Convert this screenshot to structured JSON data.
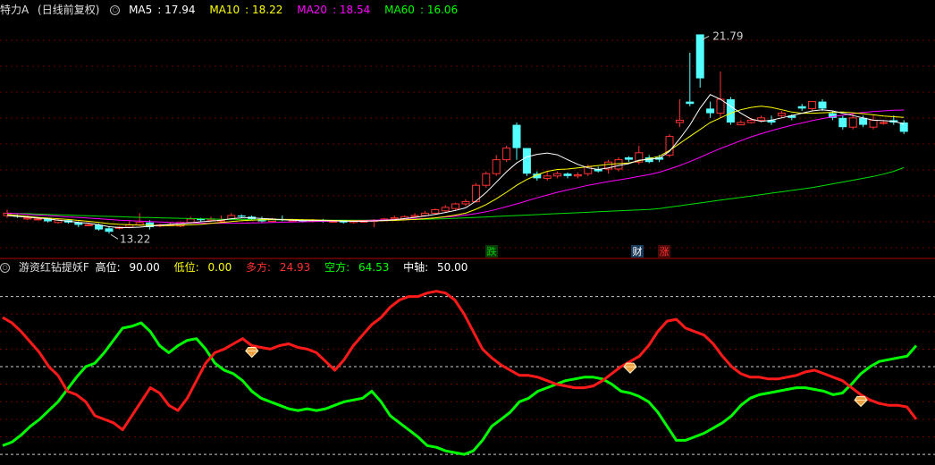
{
  "price_panel": {
    "symbol": "特力A",
    "period": "(日线前复权)",
    "ma": [
      {
        "label": "MA5",
        "value": "17.94",
        "color": "#ffffff"
      },
      {
        "label": "MA10",
        "value": "18.22",
        "color": "#ffff00"
      },
      {
        "label": "MA20",
        "value": "18.54",
        "color": "#ff00ff"
      },
      {
        "label": "MA60",
        "value": "16.06",
        "color": "#00ff00"
      }
    ],
    "high_label": "21.79",
    "low_label": "13.22",
    "markers": [
      {
        "text": "跌",
        "color": "#00cc00",
        "bg": "#0a3a0a"
      },
      {
        "text": "财",
        "color": "#ffffff",
        "bg": "#1a3a5a"
      },
      {
        "text": "涨",
        "color": "#ff3030",
        "bg": "#4a0a0a"
      }
    ]
  },
  "indicator_panel": {
    "name": "游资红钻提妖F",
    "params": [
      {
        "label": "高位:",
        "value": "90.00",
        "color": "#ffffff"
      },
      {
        "label": "低位:",
        "value": "0.00",
        "color": "#ffff00"
      },
      {
        "label": "多方:",
        "value": "24.93",
        "color": "#ff3030"
      },
      {
        "label": "空方:",
        "value": "64.53",
        "color": "#00ff00"
      },
      {
        "label": "中轴:",
        "value": "50.00",
        "color": "#ffffff"
      }
    ]
  },
  "chart_data": {
    "type": "candlestick",
    "ylim": [
      12.5,
      22.5
    ],
    "candles": [
      [
        0,
        14.0,
        14.1,
        14.25,
        13.9
      ],
      [
        1,
        14.0,
        13.95,
        14.05,
        13.9
      ],
      [
        2,
        13.85,
        13.9,
        14.0,
        13.8
      ],
      [
        3,
        13.85,
        13.85,
        13.95,
        13.8
      ],
      [
        4,
        13.85,
        13.75,
        13.9,
        13.7
      ],
      [
        5,
        13.7,
        13.8,
        13.85,
        13.65
      ],
      [
        6,
        13.8,
        13.7,
        13.85,
        13.65
      ],
      [
        7,
        13.7,
        13.6,
        13.75,
        13.5
      ],
      [
        8,
        13.6,
        13.6,
        13.7,
        13.55
      ],
      [
        9,
        13.6,
        13.4,
        13.65,
        13.35
      ],
      [
        10,
        13.45,
        13.3,
        13.5,
        13.22
      ],
      [
        11,
        13.45,
        13.5,
        13.55,
        13.4
      ],
      [
        12,
        13.5,
        13.6,
        13.75,
        13.45
      ],
      [
        13,
        13.6,
        13.7,
        14.1,
        13.55
      ],
      [
        14,
        13.7,
        13.5,
        13.8,
        13.4
      ],
      [
        15,
        13.55,
        13.6,
        13.65,
        13.5
      ],
      [
        16,
        13.6,
        13.6,
        13.7,
        13.55
      ],
      [
        17,
        13.55,
        13.7,
        13.75,
        13.5
      ],
      [
        18,
        13.7,
        13.85,
        13.95,
        13.65
      ],
      [
        19,
        13.85,
        13.8,
        13.9,
        13.75
      ],
      [
        20,
        13.8,
        13.85,
        13.95,
        13.75
      ],
      [
        21,
        13.8,
        13.8,
        14.0,
        13.7
      ],
      [
        22,
        13.85,
        14.0,
        14.1,
        13.8
      ],
      [
        23,
        14.0,
        13.95,
        14.05,
        13.9
      ],
      [
        24,
        13.95,
        13.85,
        14.0,
        13.8
      ],
      [
        25,
        13.85,
        13.75,
        13.95,
        13.7
      ],
      [
        26,
        13.75,
        13.85,
        13.9,
        13.7
      ],
      [
        27,
        13.85,
        13.8,
        14.0,
        13.75
      ],
      [
        28,
        13.8,
        13.8,
        13.85,
        13.75
      ],
      [
        29,
        13.8,
        13.75,
        13.85,
        13.7
      ],
      [
        30,
        13.75,
        13.8,
        13.85,
        13.7
      ],
      [
        31,
        13.8,
        13.75,
        13.85,
        13.7
      ],
      [
        32,
        13.75,
        13.75,
        13.8,
        13.7
      ],
      [
        33,
        13.75,
        13.7,
        13.8,
        13.65
      ],
      [
        34,
        13.7,
        13.75,
        13.8,
        13.65
      ],
      [
        35,
        13.75,
        13.75,
        13.8,
        13.7
      ],
      [
        36,
        13.75,
        13.8,
        13.85,
        13.5
      ],
      [
        37,
        13.8,
        13.85,
        13.9,
        13.75
      ],
      [
        38,
        13.85,
        13.9,
        14.0,
        13.8
      ],
      [
        39,
        13.85,
        13.95,
        14.0,
        13.8
      ],
      [
        40,
        13.95,
        14.0,
        14.1,
        13.9
      ],
      [
        41,
        14.0,
        14.1,
        14.2,
        13.95
      ],
      [
        42,
        14.1,
        14.25,
        14.3,
        14.05
      ],
      [
        43,
        14.2,
        14.35,
        14.45,
        14.15
      ],
      [
        44,
        14.3,
        14.5,
        14.55,
        14.25
      ],
      [
        45,
        14.5,
        14.6,
        14.7,
        14.4
      ],
      [
        46,
        14.6,
        15.3,
        15.4,
        14.55
      ],
      [
        47,
        15.3,
        15.8,
        15.9,
        15.2
      ],
      [
        48,
        15.8,
        16.4,
        16.6,
        15.7
      ],
      [
        49,
        16.4,
        16.9,
        17.0,
        16.3
      ],
      [
        50,
        17.9,
        16.9,
        18.0,
        16.4
      ],
      [
        51,
        16.9,
        15.8,
        16.9,
        15.7
      ],
      [
        52,
        15.8,
        15.6,
        15.9,
        15.5
      ],
      [
        53,
        15.6,
        15.7,
        15.9,
        15.5
      ],
      [
        54,
        15.7,
        15.8,
        15.9,
        15.6
      ],
      [
        55,
        15.8,
        15.7,
        15.85,
        15.6
      ],
      [
        56,
        15.7,
        15.75,
        15.85,
        15.6
      ],
      [
        57,
        15.8,
        16.1,
        16.2,
        15.7
      ],
      [
        58,
        16.0,
        15.9,
        16.1,
        15.85
      ],
      [
        59,
        16.0,
        16.3,
        16.4,
        15.8
      ],
      [
        60,
        16.0,
        16.4,
        16.5,
        15.9
      ],
      [
        61,
        16.5,
        16.4,
        16.55,
        16.3
      ],
      [
        62,
        16.3,
        16.7,
        17.0,
        16.2
      ],
      [
        63,
        16.5,
        16.3,
        16.6,
        16.25
      ],
      [
        64,
        16.5,
        16.4,
        16.6,
        16.3
      ],
      [
        65,
        16.6,
        17.4,
        17.5,
        16.5
      ],
      [
        66,
        18.0,
        18.1,
        19.0,
        17.8
      ],
      [
        67,
        18.9,
        18.8,
        21.0,
        18.7
      ],
      [
        68,
        21.79,
        19.9,
        21.79,
        19.5
      ],
      [
        69,
        18.6,
        18.4,
        18.9,
        18.2
      ],
      [
        70,
        18.4,
        19.0,
        20.2,
        18.2
      ],
      [
        71,
        19.0,
        18.0,
        19.1,
        17.9
      ],
      [
        72,
        17.9,
        18.0,
        18.1,
        17.9
      ],
      [
        73,
        18.0,
        18.1,
        18.2,
        17.95
      ],
      [
        74,
        18.1,
        18.2,
        18.3,
        18.0
      ],
      [
        75,
        18.1,
        18.0,
        18.3,
        17.9
      ],
      [
        76,
        18.3,
        18.4,
        18.5,
        18.2
      ],
      [
        77,
        18.3,
        18.2,
        18.35,
        18.1
      ],
      [
        78,
        18.7,
        18.6,
        18.8,
        18.5
      ],
      [
        79,
        18.6,
        18.9,
        18.9,
        18.5
      ],
      [
        80,
        18.9,
        18.6,
        19.0,
        18.5
      ],
      [
        81,
        18.4,
        18.2,
        18.5,
        18.1
      ],
      [
        82,
        18.2,
        17.8,
        18.3,
        17.7
      ],
      [
        83,
        17.8,
        18.2,
        18.4,
        17.7
      ],
      [
        84,
        18.2,
        17.9,
        18.3,
        17.8
      ],
      [
        85,
        17.8,
        18.1,
        18.3,
        17.7
      ],
      [
        86,
        18.0,
        18.0,
        18.1,
        17.9
      ],
      [
        87,
        18.1,
        18.0,
        18.3,
        17.9
      ],
      [
        88,
        18.0,
        17.6,
        18.1,
        17.5
      ]
    ],
    "ma5": [
      14.0,
      13.96,
      13.93,
      13.89,
      13.86,
      13.8,
      13.76,
      13.7,
      13.67,
      13.6,
      13.52,
      13.48,
      13.48,
      13.5,
      13.54,
      13.58,
      13.62,
      13.64,
      13.68,
      13.73,
      13.76,
      13.8,
      13.86,
      13.9,
      13.9,
      13.87,
      13.85,
      13.82,
      13.8,
      13.78,
      13.78,
      13.78,
      13.77,
      13.76,
      13.75,
      13.75,
      13.77,
      13.79,
      13.82,
      13.87,
      13.92,
      13.98,
      14.05,
      14.13,
      14.22,
      14.33,
      14.62,
      14.99,
      15.43,
      15.88,
      16.26,
      16.52,
      16.63,
      16.69,
      16.61,
      16.4,
      16.2,
      16.05,
      15.98,
      16.05,
      16.15,
      16.23,
      16.38,
      16.42,
      16.46,
      16.76,
      17.3,
      17.89,
      18.62,
      19.2,
      19.0,
      18.7,
      18.4,
      18.15,
      18.05,
      18.1,
      18.2,
      18.3,
      18.4,
      18.5,
      18.55,
      18.5,
      18.4,
      18.3,
      18.2,
      18.1,
      18.08,
      18.05,
      17.94
    ],
    "ma10": [
      14.05,
      14.0,
      13.96,
      13.92,
      13.89,
      13.86,
      13.83,
      13.79,
      13.75,
      13.7,
      13.65,
      13.62,
      13.6,
      13.59,
      13.58,
      13.57,
      13.57,
      13.58,
      13.6,
      13.62,
      13.66,
      13.7,
      13.74,
      13.78,
      13.8,
      13.82,
      13.83,
      13.83,
      13.83,
      13.82,
      13.81,
      13.8,
      13.79,
      13.78,
      13.77,
      13.77,
      13.77,
      13.78,
      13.79,
      13.81,
      13.83,
      13.86,
      13.9,
      13.95,
      14.02,
      14.1,
      14.27,
      14.47,
      14.72,
      15.0,
      15.3,
      15.55,
      15.75,
      15.9,
      15.98,
      16.0,
      16.05,
      16.1,
      16.15,
      16.2,
      16.23,
      16.26,
      16.35,
      16.45,
      16.55,
      16.8,
      17.1,
      17.4,
      17.7,
      18.0,
      18.2,
      18.4,
      18.55,
      18.65,
      18.7,
      18.65,
      18.55,
      18.45,
      18.4,
      18.4,
      18.42,
      18.44,
      18.45,
      18.42,
      18.38,
      18.33,
      18.28,
      18.25,
      18.22
    ],
    "ma20": [
      14.1,
      14.08,
      14.05,
      14.02,
      14.0,
      13.97,
      13.94,
      13.92,
      13.89,
      13.86,
      13.83,
      13.8,
      13.78,
      13.76,
      13.74,
      13.72,
      13.7,
      13.69,
      13.68,
      13.67,
      13.67,
      13.67,
      13.67,
      13.67,
      13.68,
      13.69,
      13.7,
      13.71,
      13.72,
      13.73,
      13.74,
      13.75,
      13.76,
      13.77,
      13.78,
      13.79,
      13.8,
      13.81,
      13.82,
      13.83,
      13.85,
      13.87,
      13.9,
      13.93,
      13.97,
      14.02,
      14.08,
      14.16,
      14.26,
      14.38,
      14.5,
      14.63,
      14.76,
      14.88,
      15.0,
      15.1,
      15.2,
      15.3,
      15.38,
      15.46,
      15.53,
      15.6,
      15.68,
      15.76,
      15.86,
      16.0,
      16.15,
      16.32,
      16.5,
      16.7,
      16.88,
      17.05,
      17.22,
      17.38,
      17.52,
      17.65,
      17.77,
      17.88,
      17.98,
      18.08,
      18.17,
      18.25,
      18.32,
      18.38,
      18.43,
      18.47,
      18.5,
      18.53,
      18.54
    ],
    "ma60": [
      14.1,
      14.09,
      14.08,
      14.06,
      14.05,
      14.03,
      14.02,
      14.0,
      13.99,
      13.97,
      13.96,
      13.95,
      13.93,
      13.92,
      13.91,
      13.9,
      13.89,
      13.88,
      13.87,
      13.86,
      13.85,
      13.84,
      13.83,
      13.83,
      13.82,
      13.82,
      13.81,
      13.81,
      13.8,
      13.8,
      13.8,
      13.8,
      13.8,
      13.8,
      13.8,
      13.8,
      13.8,
      13.81,
      13.81,
      13.82,
      13.83,
      13.84,
      13.85,
      13.86,
      13.88,
      13.9,
      13.92,
      13.94,
      13.96,
      13.98,
      14.0,
      14.02,
      14.04,
      14.06,
      14.08,
      14.1,
      14.12,
      14.14,
      14.16,
      14.18,
      14.2,
      14.22,
      14.24,
      14.26,
      14.3,
      14.36,
      14.42,
      14.48,
      14.54,
      14.6,
      14.66,
      14.72,
      14.78,
      14.84,
      14.9,
      14.96,
      15.02,
      15.08,
      15.14,
      15.2,
      15.28,
      15.36,
      15.44,
      15.52,
      15.6,
      15.68,
      15.78,
      15.9,
      16.06
    ],
    "indicator": {
      "ylim": [
        -2,
        100
      ],
      "red": [
        78,
        75,
        70,
        64,
        58,
        50,
        45,
        36,
        34,
        30,
        22,
        20,
        18,
        14,
        22,
        30,
        38,
        35,
        28,
        25,
        32,
        42,
        52,
        58,
        60,
        63,
        66,
        62,
        61,
        60,
        62,
        63,
        61,
        60,
        58,
        53,
        48,
        54,
        62,
        68,
        74,
        78,
        84,
        88,
        90,
        90,
        92,
        93,
        92,
        88,
        80,
        70,
        60,
        55,
        51,
        48,
        45,
        45,
        44,
        42,
        40,
        39,
        38,
        38,
        39,
        42,
        46,
        50,
        53,
        56,
        62,
        70,
        76,
        77,
        72,
        70,
        68,
        63,
        56,
        50,
        46,
        44,
        44,
        43,
        43,
        44,
        45,
        47,
        48,
        46,
        44,
        42,
        38,
        34,
        31,
        29,
        28,
        28,
        27,
        20
      ],
      "green": [
        5,
        7,
        11,
        16,
        20,
        25,
        30,
        37,
        44,
        50,
        52,
        58,
        65,
        72,
        73,
        75,
        70,
        62,
        58,
        62,
        65,
        66,
        60,
        52,
        48,
        46,
        42,
        36,
        32,
        30,
        28,
        26,
        25,
        26,
        25,
        26,
        28,
        30,
        31,
        32,
        36,
        30,
        22,
        18,
        14,
        10,
        5,
        4,
        2,
        1,
        0,
        2,
        8,
        16,
        20,
        24,
        30,
        32,
        36,
        38,
        40,
        42,
        43,
        44,
        44,
        43,
        40,
        36,
        35,
        33,
        30,
        24,
        16,
        8,
        8,
        10,
        12,
        15,
        18,
        22,
        28,
        32,
        34,
        35,
        36,
        37,
        38,
        38,
        37,
        36,
        34,
        35,
        40,
        46,
        50,
        53,
        54,
        55,
        56,
        62
      ],
      "diamonds_at_index": [
        27,
        68,
        93
      ]
    }
  }
}
